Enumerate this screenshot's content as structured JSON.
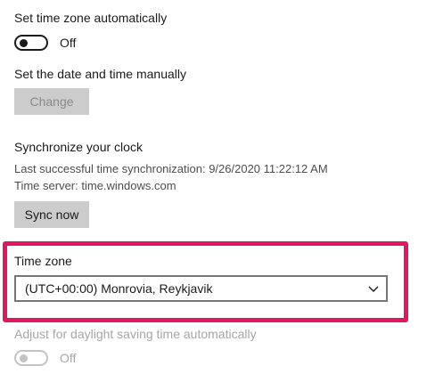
{
  "auto_timezone": {
    "title": "Set time zone automatically",
    "state": "Off",
    "enabled": false
  },
  "manual_time": {
    "title": "Set the date and time manually",
    "button_label": "Change"
  },
  "sync": {
    "title": "Synchronize your clock",
    "last_sync": "Last successful time synchronization: 9/26/2020 11:22:12 AM",
    "server": "Time server: time.windows.com",
    "button_label": "Sync now"
  },
  "timezone": {
    "title": "Time zone",
    "selected": "(UTC+00:00) Monrovia, Reykjavik"
  },
  "daylight": {
    "title": "Adjust for daylight saving time automatically",
    "state": "Off",
    "enabled": false
  },
  "colors": {
    "highlight": "#e3175f",
    "button_bg": "#cccccc",
    "disabled_text": "#a6a6a6"
  },
  "icons": {
    "dropdown": "chevron-down-icon"
  }
}
